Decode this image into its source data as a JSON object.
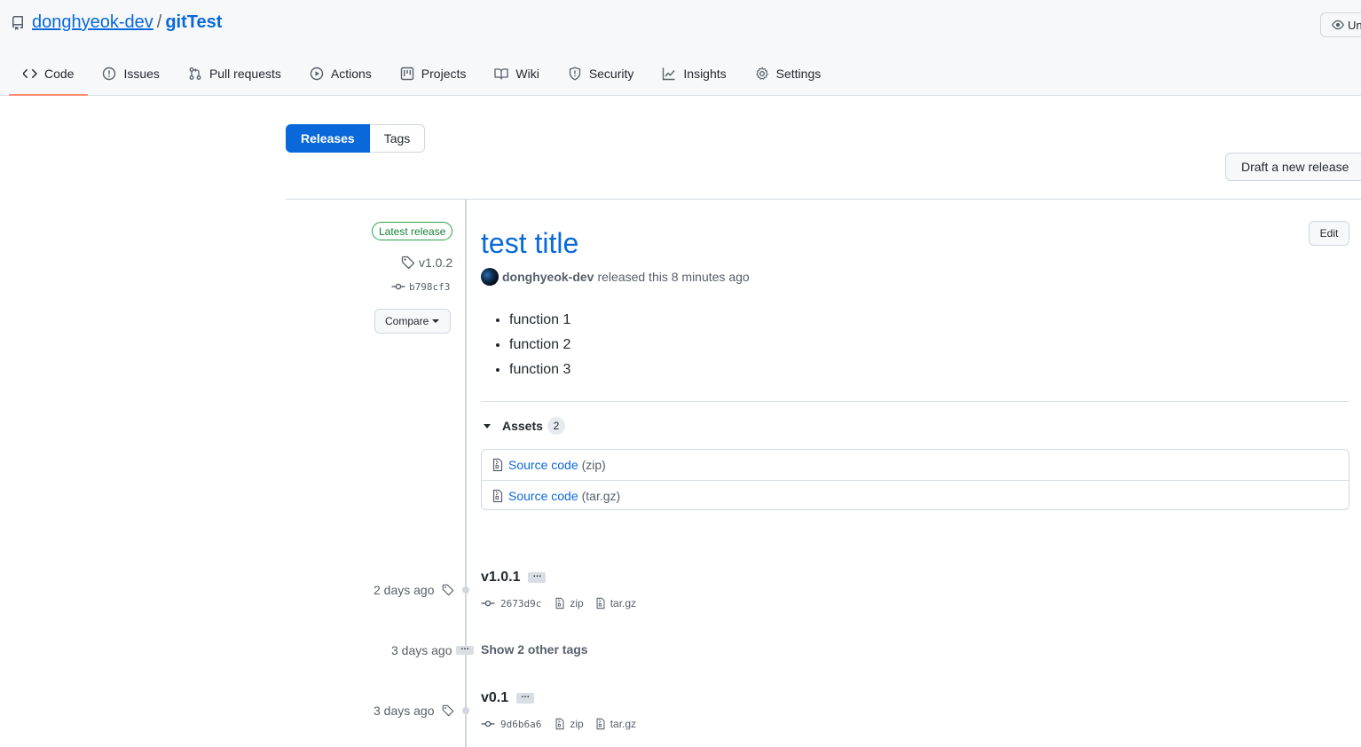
{
  "repo": {
    "owner": "donghyeok-dev",
    "separator": "/",
    "name": "gitTest",
    "watch_label": "Un"
  },
  "tabs": [
    {
      "label": "Code",
      "selected": true
    },
    {
      "label": "Issues"
    },
    {
      "label": "Pull requests"
    },
    {
      "label": "Actions"
    },
    {
      "label": "Projects"
    },
    {
      "label": "Wiki"
    },
    {
      "label": "Security"
    },
    {
      "label": "Insights"
    },
    {
      "label": "Settings"
    }
  ],
  "subnav": {
    "releases": "Releases",
    "tags": "Tags"
  },
  "draft_button": "Draft a new release",
  "latest": {
    "badge": "Latest release",
    "tag": "v1.0.2",
    "commit": "b798cf3",
    "compare": "Compare",
    "title": "test title",
    "edit": "Edit",
    "author": "donghyeok-dev",
    "released_text": "released this 8 minutes ago",
    "notes": [
      "function 1",
      "function 2",
      "function 3"
    ],
    "assets_label": "Assets",
    "assets_count": "2",
    "assets": [
      {
        "name": "Source code",
        "ext": "(zip)"
      },
      {
        "name": "Source code",
        "ext": "(tar.gz)"
      }
    ]
  },
  "older": [
    {
      "date": "2 days ago",
      "tag": "v1.0.1",
      "ellipsis": "…",
      "commit": "2673d9c",
      "zip": "zip",
      "targz": "tar.gz"
    },
    {
      "date": "3 days ago",
      "tag": "v0.1",
      "ellipsis": "…",
      "commit": "9d6b6a6",
      "zip": "zip",
      "targz": "tar.gz"
    }
  ],
  "collapsed": {
    "date": "3 days ago",
    "ellipsis": "…",
    "label": "Show 2 other tags"
  }
}
